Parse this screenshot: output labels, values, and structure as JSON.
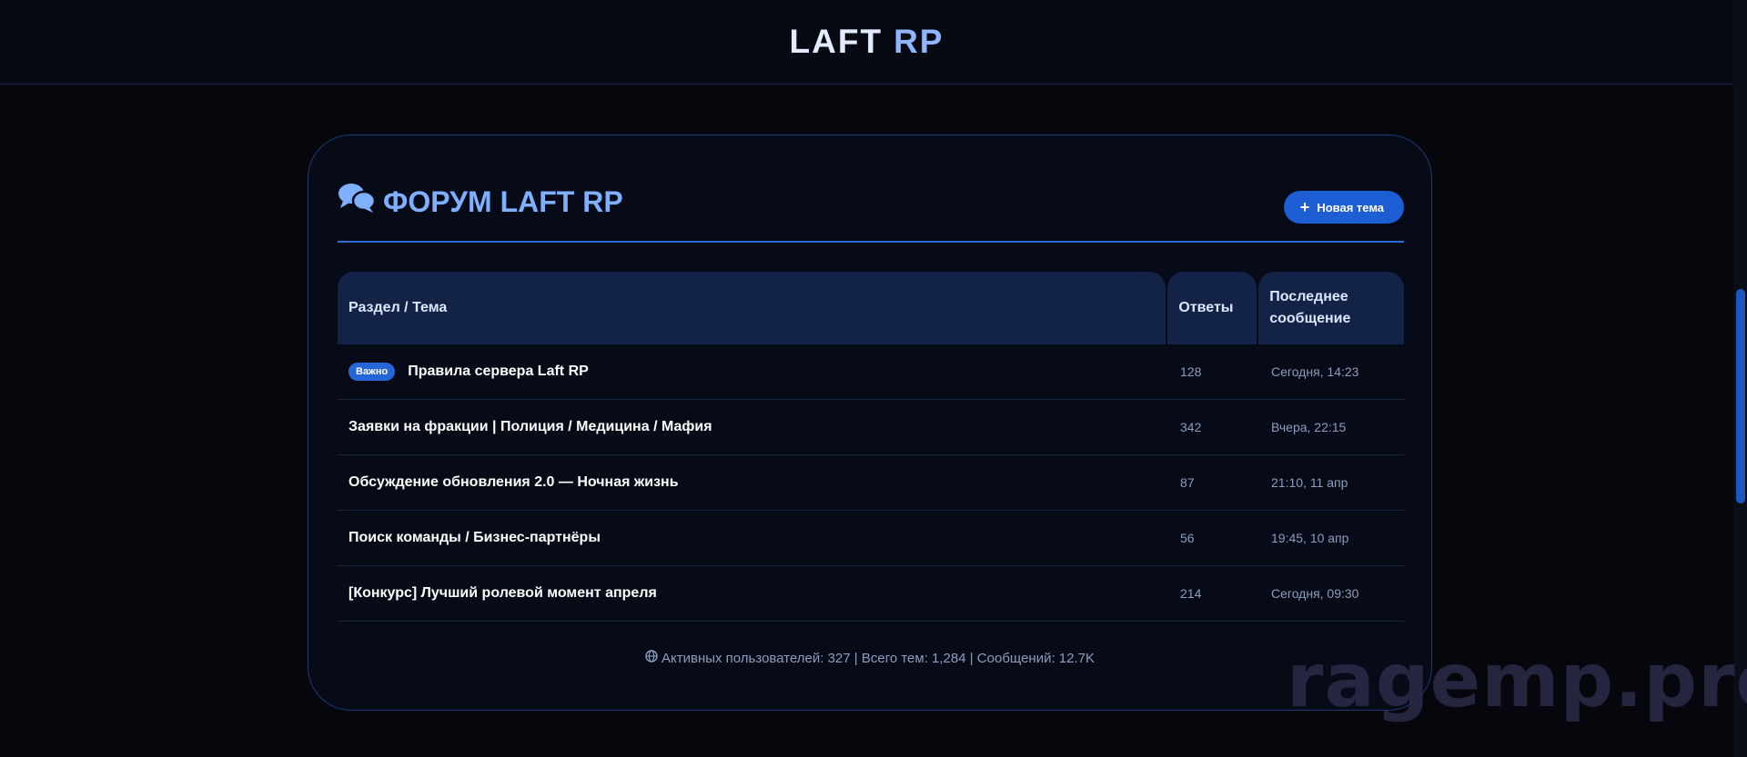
{
  "header": {
    "brand_part1": "LAFT",
    "brand_part2": "RP"
  },
  "forum": {
    "title": "ФОРУМ LAFT RP",
    "new_topic_label": "Новая тема",
    "columns": {
      "topic": "Раздел / Тема",
      "replies": "Ответы",
      "last_post": "Последнее сообщение"
    },
    "rows": [
      {
        "badge": "Важно",
        "title": "Правила сервера Laft RP",
        "replies": "128",
        "last": "Сегодня, 14:23"
      },
      {
        "title": "Заявки на фракции | Полиция / Медицина / Мафия",
        "replies": "342",
        "last": "Вчера, 22:15"
      },
      {
        "title": "Обсуждение обновления 2.0 — Ночная жизнь",
        "replies": "87",
        "last": "21:10, 11 апр"
      },
      {
        "title": "Поиск команды / Бизнес-партнёры",
        "replies": "56",
        "last": "19:45, 10 апр"
      },
      {
        "title": "[Конкурс] Лучший ролевой момент апреля",
        "replies": "214",
        "last": "Сегодня, 09:30"
      }
    ],
    "stats": "Активных пользователей: 327 | Всего тем: 1,284 | Сообщений: 12.7K"
  },
  "watermark": "ragemp.pro",
  "colors": {
    "accent": "#1d5ed4",
    "title": "#7fb0ff",
    "background": "#05070c"
  },
  "icons": {
    "forum_icon": "comments-icon",
    "new_topic_icon": "plus-icon",
    "stats_icon": "globe-icon"
  }
}
